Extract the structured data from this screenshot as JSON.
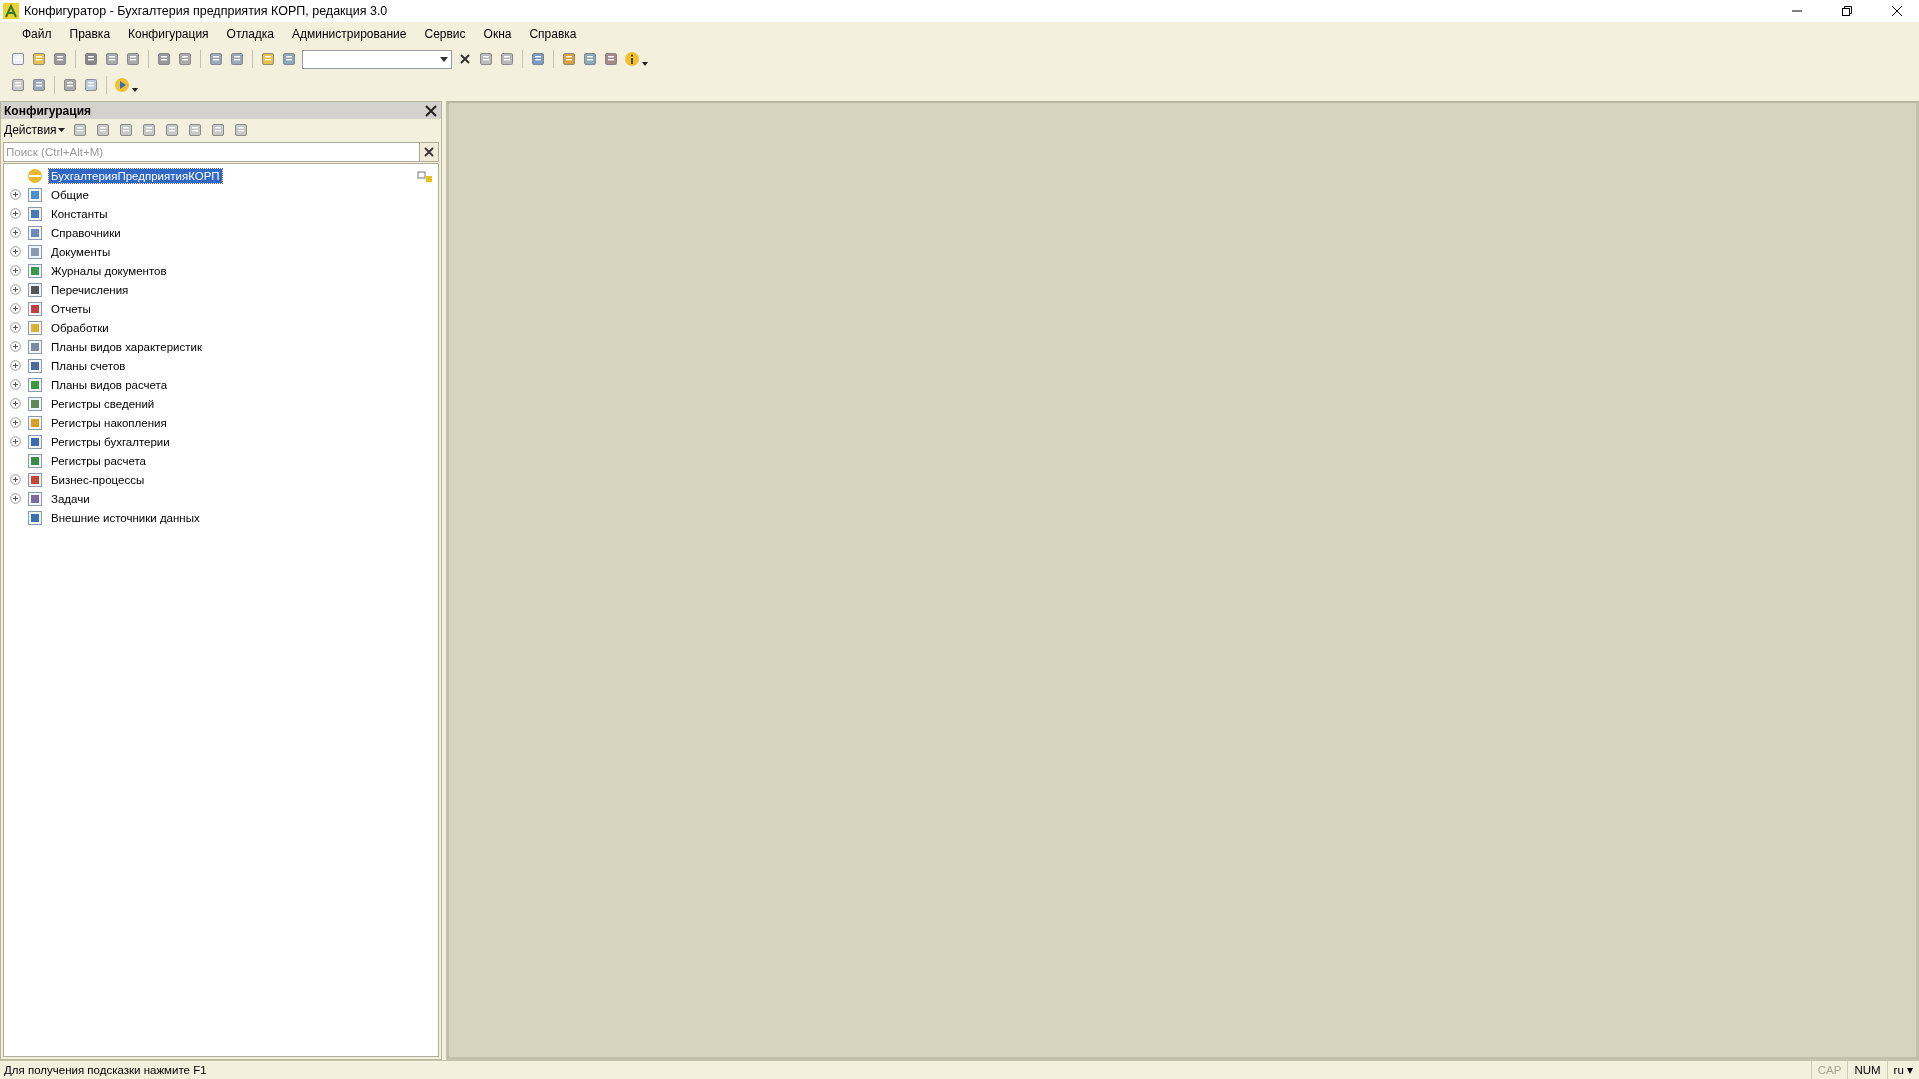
{
  "window": {
    "title": "Конфигуратор - Бухгалтерия предприятия КОРП, редакция 3.0"
  },
  "menu": [
    "Файл",
    "Правка",
    "Конфигурация",
    "Отладка",
    "Администрирование",
    "Сервис",
    "Окна",
    "Справка"
  ],
  "panel": {
    "title": "Конфигурация",
    "actions_label": "Действия",
    "search": {
      "placeholder": "Поиск (Ctrl+Alt+M)"
    },
    "tree": [
      {
        "label": "БухгалтерияПредприятияКОРП",
        "selected": true,
        "expandable": false
      },
      {
        "label": "Общие",
        "selected": false,
        "expandable": true
      },
      {
        "label": "Константы",
        "selected": false,
        "expandable": true
      },
      {
        "label": "Справочники",
        "selected": false,
        "expandable": true
      },
      {
        "label": "Документы",
        "selected": false,
        "expandable": true
      },
      {
        "label": "Журналы документов",
        "selected": false,
        "expandable": true
      },
      {
        "label": "Перечисления",
        "selected": false,
        "expandable": true
      },
      {
        "label": "Отчеты",
        "selected": false,
        "expandable": true
      },
      {
        "label": "Обработки",
        "selected": false,
        "expandable": true
      },
      {
        "label": "Планы видов характеристик",
        "selected": false,
        "expandable": true
      },
      {
        "label": "Планы счетов",
        "selected": false,
        "expandable": true
      },
      {
        "label": "Планы видов расчета",
        "selected": false,
        "expandable": true
      },
      {
        "label": "Регистры сведений",
        "selected": false,
        "expandable": true
      },
      {
        "label": "Регистры накопления",
        "selected": false,
        "expandable": true
      },
      {
        "label": "Регистры бухгалтерии",
        "selected": false,
        "expandable": true
      },
      {
        "label": "Регистры расчета",
        "selected": false,
        "expandable": false
      },
      {
        "label": "Бизнес-процессы",
        "selected": false,
        "expandable": true
      },
      {
        "label": "Задачи",
        "selected": false,
        "expandable": true
      },
      {
        "label": "Внешние источники данных",
        "selected": false,
        "expandable": false
      }
    ]
  },
  "status_bar": {
    "hint": "Для получения подсказки нажмите F1",
    "indicators": [
      {
        "label": "CAP",
        "active": false
      },
      {
        "label": "NUM",
        "active": true
      },
      {
        "label": "ru ▾",
        "active": true
      }
    ]
  }
}
